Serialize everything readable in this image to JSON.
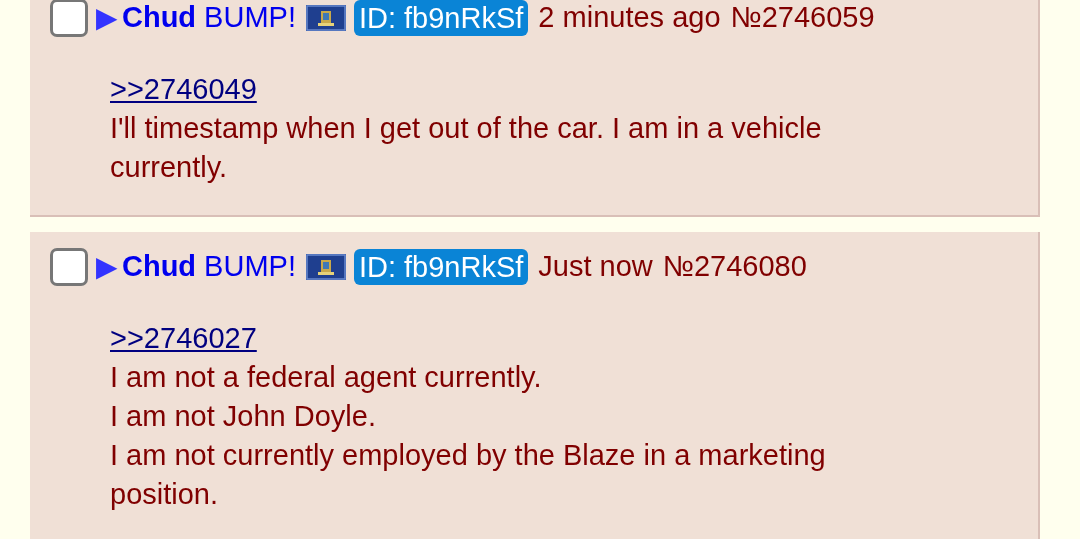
{
  "posts": [
    {
      "checked": false,
      "marker": "▶",
      "name": "Chud",
      "subject": "BUMP!",
      "poster_id": "ID: fb9nRkSf",
      "time": "2 minutes ago",
      "number": "№2746059",
      "quote_link": ">>2746049",
      "lines": [
        "I'll timestamp when I get out of the car. I am in a vehicle currently."
      ]
    },
    {
      "checked": false,
      "marker": "▶",
      "name": "Chud",
      "subject": "BUMP!",
      "poster_id": "ID: fb9nRkSf",
      "time": "Just now",
      "number": "№2746080",
      "quote_link": ">>2746027",
      "lines": [
        "I am not a federal agent currently.",
        "I am not John Doyle.",
        "I am not currently employed by the Blaze in a marketing position."
      ]
    }
  ]
}
